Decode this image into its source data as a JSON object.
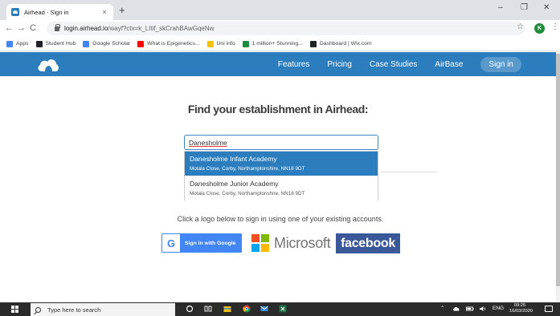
{
  "browser": {
    "tab_title": "Airhead - Sign in",
    "tab_close": "×",
    "new_tab": "+",
    "url_host": "login.airhead.io",
    "url_path": "/wayf?ctx=k_LItif_skCrahBAwGqeNw",
    "profile_initial": "K",
    "win_min": "–",
    "win_max": "❐",
    "win_close": "✕",
    "back": "←",
    "forward": "→",
    "reload": "C",
    "star": "☆",
    "menu": "⋮",
    "bookmarks": [
      {
        "label": "Apps",
        "color": "#4285f4"
      },
      {
        "label": "Student Hub",
        "color": "#202124"
      },
      {
        "label": "Google Scholar",
        "color": "#4285f4"
      },
      {
        "label": "What is Epigenetics...",
        "color": "#ff0000"
      },
      {
        "label": "Uni info",
        "color": "#f4c20d"
      },
      {
        "label": "1 million+ Stunning...",
        "color": "#1e8e3e"
      },
      {
        "label": "Dashboard | Wix.com",
        "color": "#202124"
      }
    ]
  },
  "site": {
    "nav": {
      "features": "Features",
      "pricing": "Pricing",
      "case_studies": "Case Studies",
      "airbase": "AirBase",
      "sign_in": "Sign in"
    },
    "heading": "Find your establishment in Airhead:",
    "search_value": "Danesholme",
    "suggestions": [
      {
        "name": "Danesholme Infant Academy",
        "address": "Motala Close, Corby, Northamptonshire, NN18 9DT"
      },
      {
        "name": "Danesholme Junior Academy",
        "address": "Motala Close, Corby, Northamptonshire, NN18 9DT"
      }
    ],
    "instruction": "Click a logo below to sign in using one of your existing accounts.",
    "google_label": "Sign in with Google",
    "google_g": "G",
    "microsoft_label": "Microsoft",
    "facebook_label": "facebook",
    "accent_color": "#2b7dbd"
  },
  "taskbar": {
    "search_placeholder": "Type here to search",
    "language": "ENG",
    "time": "09:25",
    "date": "16/03/2020"
  }
}
